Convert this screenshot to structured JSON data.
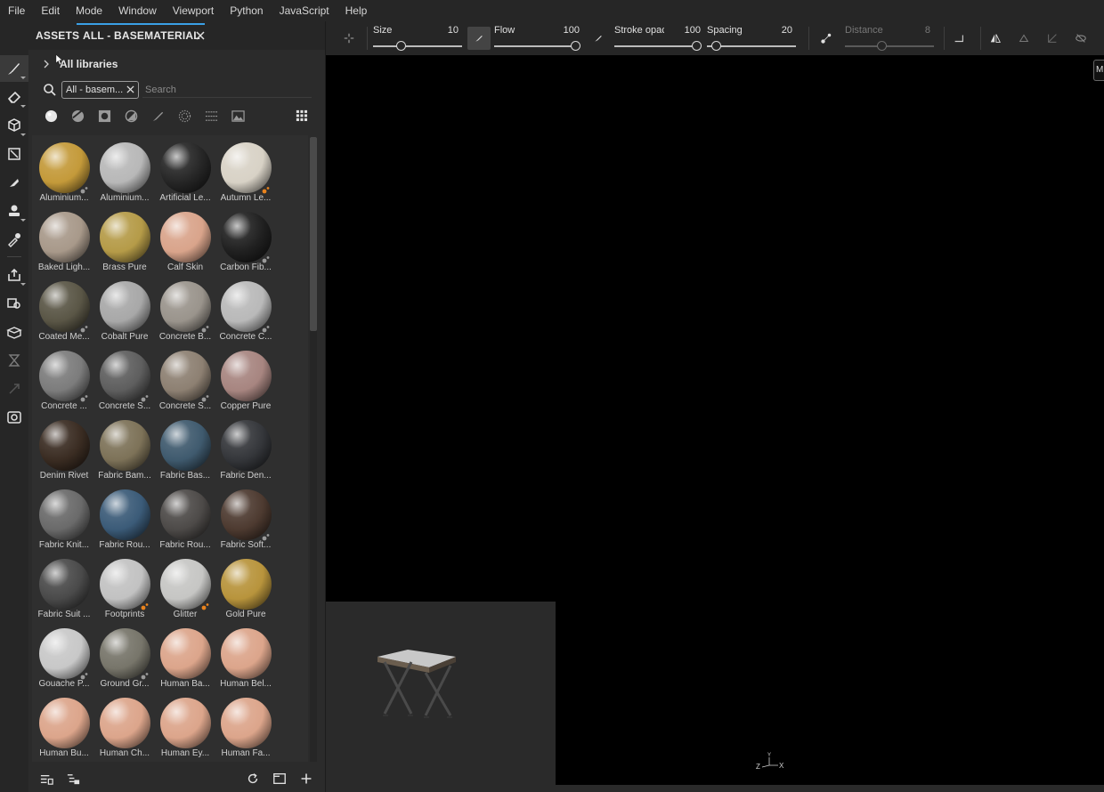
{
  "menu": [
    "File",
    "Edit",
    "Mode",
    "Window",
    "Viewport",
    "Python",
    "JavaScript",
    "Help"
  ],
  "panel": {
    "tab_assets": "ASSETS",
    "tab_current": "ALL - BASEMATERIAL",
    "library_label": "All libraries",
    "search_chip": "All - basem...",
    "search_placeholder": "Search"
  },
  "materials": [
    {
      "label": "Aluminium...",
      "color": "#c49a3a",
      "badge": "gray"
    },
    {
      "label": "Aluminium...",
      "color": "#b8b8b8",
      "badge": ""
    },
    {
      "label": "Artificial Le...",
      "color": "#262626",
      "badge": ""
    },
    {
      "label": "Autumn Le...",
      "color": "#d8d2c6",
      "badge": "orange"
    },
    {
      "label": "Baked Ligh...",
      "color": "#a8998a",
      "badge": ""
    },
    {
      "label": "Brass Pure",
      "color": "#b59b48",
      "badge": ""
    },
    {
      "label": "Calf Skin",
      "color": "#d9a48b",
      "badge": ""
    },
    {
      "label": "Carbon Fib...",
      "color": "#202020",
      "badge": "gray"
    },
    {
      "label": "Coated Me...",
      "color": "#5a5646",
      "badge": "gray"
    },
    {
      "label": "Cobalt Pure",
      "color": "#a8a8a8",
      "badge": ""
    },
    {
      "label": "Concrete B...",
      "color": "#9a948c",
      "badge": "gray"
    },
    {
      "label": "Concrete C...",
      "color": "#b9b9b9",
      "badge": "gray"
    },
    {
      "label": "Concrete ...",
      "color": "#7c7c7c",
      "badge": "gray"
    },
    {
      "label": "Concrete S...",
      "color": "#5e5e5e",
      "badge": "gray"
    },
    {
      "label": "Concrete S...",
      "color": "#8d8072",
      "badge": "gray"
    },
    {
      "label": "Copper Pure",
      "color": "#a78580",
      "badge": ""
    },
    {
      "label": "Denim Rivet",
      "color": "#3a2c22",
      "badge": ""
    },
    {
      "label": "Fabric Bam...",
      "color": "#7d7258",
      "badge": ""
    },
    {
      "label": "Fabric Bas...",
      "color": "#3f5a6e",
      "badge": ""
    },
    {
      "label": "Fabric Den...",
      "color": "#34363a",
      "badge": ""
    },
    {
      "label": "Fabric Knit...",
      "color": "#6a6a6a",
      "badge": ""
    },
    {
      "label": "Fabric Rou...",
      "color": "#3b5b78",
      "badge": ""
    },
    {
      "label": "Fabric Rou...",
      "color": "#4d4a48",
      "badge": ""
    },
    {
      "label": "Fabric Soft...",
      "color": "#4d3a30",
      "badge": "gray"
    },
    {
      "label": "Fabric Suit ...",
      "color": "#4a4a4a",
      "badge": ""
    },
    {
      "label": "Footprints",
      "color": "#c2c2c2",
      "badge": "orange"
    },
    {
      "label": "Glitter",
      "color": "#c6c6c4",
      "badge": "orange"
    },
    {
      "label": "Gold Pure",
      "color": "#b8943c",
      "badge": ""
    },
    {
      "label": "Gouache P...",
      "color": "#c8c8c8",
      "badge": "gray"
    },
    {
      "label": "Ground Gr...",
      "color": "#77756a",
      "badge": "gray"
    },
    {
      "label": "Human Ba...",
      "color": "#dca58b",
      "badge": ""
    },
    {
      "label": "Human Bel...",
      "color": "#dca58b",
      "badge": ""
    },
    {
      "label": "Human Bu...",
      "color": "#dca58b",
      "badge": ""
    },
    {
      "label": "Human Ch...",
      "color": "#dca58b",
      "badge": ""
    },
    {
      "label": "Human Ey...",
      "color": "#dca58b",
      "badge": ""
    },
    {
      "label": "Human Fa...",
      "color": "#dca58b",
      "badge": ""
    }
  ],
  "toolbar": {
    "size_label": "Size",
    "size_value": "10",
    "flow_label": "Flow",
    "flow_value": "100",
    "stroke_label": "Stroke opac",
    "stroke_value": "100",
    "spacing_label": "Spacing",
    "spacing_value": "20",
    "distance_label": "Distance",
    "distance_value": "8"
  },
  "viewport": {
    "axis_z": "Z",
    "axis_x": "X",
    "axis_y": "Y",
    "tag": "M"
  },
  "colors": {
    "accent": "#3aa0e6",
    "badge_orange": "#e8831e",
    "badge_gray": "#9a9a9a"
  }
}
